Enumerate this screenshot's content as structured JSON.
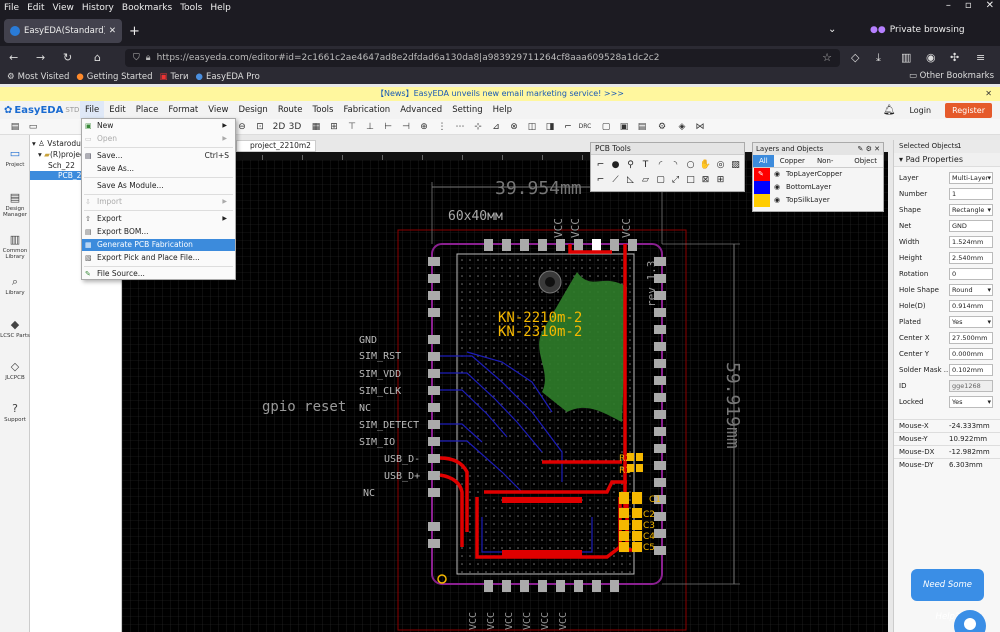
{
  "browser": {
    "menu": [
      "File",
      "Edit",
      "View",
      "History",
      "Bookmarks",
      "Tools",
      "Help"
    ],
    "tab_title": "EasyEDA(Standard) - A Si",
    "private_label": "Private browsing",
    "url": "https://easyeda.com/editor#id=2c1661c2ae4647ad8e2dfdad6a130da8|a983929711264cf8aaa609528a1dc2c2",
    "bookmarks": [
      "Most Visited",
      "Getting Started",
      "Terи",
      "EasyEDA Pro"
    ],
    "other_bookmarks": "Other Bookmarks"
  },
  "news": "【News】EasyEDA unveils new email marketing service! >>>",
  "app": {
    "logo": "EasyEDA",
    "edition": "STD",
    "menu": [
      "File",
      "Edit",
      "Place",
      "Format",
      "View",
      "Design",
      "Route",
      "Tools",
      "Fabrication",
      "Advanced",
      "Setting",
      "Help"
    ],
    "login": "Login",
    "register": "Register"
  },
  "sidebar": [
    "Project",
    "Design Manager",
    "Common Library",
    "Library",
    "LCSC Parts",
    "JLCPCB",
    "Support"
  ],
  "tree": {
    "root": "Vstarodu",
    "project": "(R)project",
    "sch": "Sch_22",
    "pcb": "PCB_2"
  },
  "doc_tab": "project_2210m2",
  "file_menu": {
    "items": [
      {
        "label": "New",
        "sub": true,
        "disabled": false
      },
      {
        "label": "Open",
        "sub": true,
        "disabled": true
      },
      {
        "label": "Save...",
        "shortcut": "Ctrl+S",
        "disabled": false
      },
      {
        "label": "Save As...",
        "disabled": false
      },
      {
        "label": "Save As Module...",
        "disabled": false
      },
      {
        "label": "Import",
        "sub": true,
        "disabled": true
      },
      {
        "label": "Export",
        "sub": true,
        "disabled": false
      },
      {
        "label": "Export BOM...",
        "disabled": false
      },
      {
        "label": "Generate PCB Fabrication File(Gerber)...",
        "disabled": false,
        "highlighted": true
      },
      {
        "label": "Export Pick and Place File...",
        "disabled": false
      },
      {
        "label": "File Source...",
        "disabled": false
      }
    ]
  },
  "pcb_tools": {
    "title": "PCB Tools"
  },
  "layers": {
    "title": "Layers and Objects",
    "tabs": [
      "All",
      "Copper",
      "Non-Copper",
      "Object"
    ],
    "rows": [
      {
        "name": "TopLayer",
        "color": "#ff0000"
      },
      {
        "name": "BottomLayer",
        "color": "#0000ff"
      },
      {
        "name": "TopSilkLayer",
        "color": "#ffcc00"
      }
    ]
  },
  "props": {
    "selected_label": "Selected Objects",
    "selected_count": "1",
    "section": "Pad Properties",
    "rows": [
      {
        "label": "Layer",
        "value": "Multi-Layer",
        "select": true
      },
      {
        "label": "Number",
        "value": "1"
      },
      {
        "label": "Shape",
        "value": "Rectangle",
        "select": true
      },
      {
        "label": "Net",
        "value": "GND"
      },
      {
        "label": "Width",
        "value": "1.524mm"
      },
      {
        "label": "Height",
        "value": "2.540mm"
      },
      {
        "label": "Rotation",
        "value": "0"
      },
      {
        "label": "Hole Shape",
        "value": "Round",
        "select": true
      },
      {
        "label": "Hole(D)",
        "value": "0.914mm"
      },
      {
        "label": "Plated",
        "value": "Yes",
        "select": true
      },
      {
        "label": "Center X",
        "value": "27.500mm"
      },
      {
        "label": "Center Y",
        "value": "0.000mm"
      },
      {
        "label": "Solder Mask ...",
        "value": "0.102mm"
      },
      {
        "label": "ID",
        "value": "gge1268",
        "readonly": true
      },
      {
        "label": "Locked",
        "value": "Yes",
        "select": true
      }
    ],
    "mouse": [
      {
        "label": "Mouse-X",
        "value": "-24.333mm"
      },
      {
        "label": "Mouse-Y",
        "value": "10.922mm"
      },
      {
        "label": "Mouse-DX",
        "value": "-12.982mm"
      },
      {
        "label": "Mouse-DY",
        "value": "6.303mm"
      }
    ]
  },
  "canvas": {
    "dim_top": "39.954mm",
    "dim_right": "59.919mm",
    "board_size": "60x40мм",
    "part_labels": [
      "KN-2210m-2",
      "KN-2310m-2"
    ],
    "rev": "rev 1.3",
    "gpio": "gpio reset",
    "pin_labels": [
      "GND",
      "SIM_RST",
      "SIM_VDD",
      "SIM_CLK",
      "NC",
      "SIM_DETECT",
      "SIM_IO",
      "USB_D-",
      "USB_D+",
      "NC"
    ],
    "vcc_top": [
      "VCC",
      "VCC",
      "VCC"
    ],
    "vcc_bottom": [
      "VCC",
      "VCC",
      "VCC",
      "VCC",
      "VCC",
      "VCC"
    ],
    "refdes": [
      "R2",
      "R1",
      "C1",
      "C2",
      "C3",
      "C4",
      "C5"
    ]
  },
  "help": "Need Some Help?"
}
